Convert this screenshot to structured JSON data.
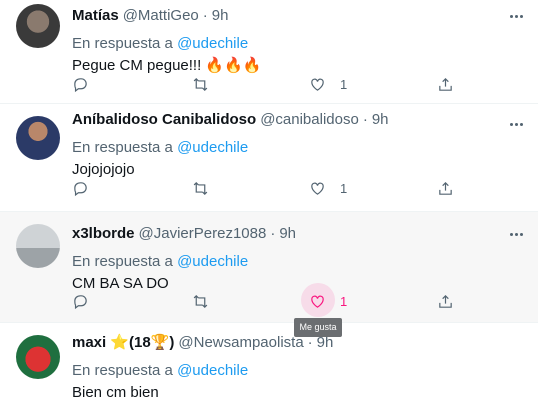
{
  "reply_prefix": "En respuesta a",
  "tweets": [
    {
      "name": "Matías",
      "handle": "@MattiGeo",
      "time": "9h",
      "mention": "@udechile",
      "text": "Pegue CM pegue!!! 🔥🔥🔥",
      "likes": "1"
    },
    {
      "name": "Aníbalidoso Canibalidoso",
      "handle": "@canibalidoso",
      "time": "9h",
      "mention": "@udechile",
      "text": "Jojojojojo",
      "likes": "1"
    },
    {
      "name": "x3lborde",
      "handle": "@JavierPerez1088",
      "time": "9h",
      "mention": "@udechile",
      "text": "CM BA SA DO",
      "likes": "1"
    },
    {
      "name": "maxi ⭐(18🏆)",
      "handle": "@Newsampaolista",
      "time": "9h",
      "mention": "@udechile",
      "text": "Bien cm bien"
    }
  ],
  "tooltip": "Me gusta",
  "icons": {
    "reply": "reply-icon",
    "retweet": "retweet-icon",
    "like": "heart-icon",
    "share": "share-icon",
    "more": "more-icon"
  },
  "colors": {
    "link": "#1d9bf0",
    "like_active": "#f91880",
    "muted": "#536471"
  }
}
